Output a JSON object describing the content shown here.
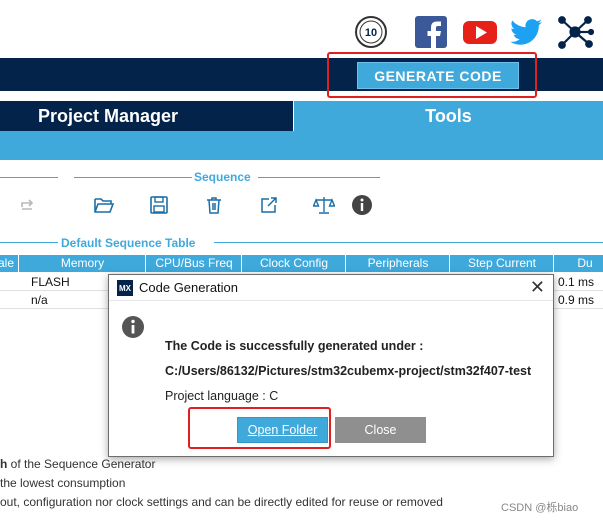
{
  "header": {
    "generate_label": "GENERATE CODE"
  },
  "social_icons": [
    "anniversary-badge-icon",
    "facebook-icon",
    "youtube-icon",
    "twitter-icon",
    "network-icon"
  ],
  "badge": {
    "number": "10"
  },
  "tabs": [
    {
      "label": "Project Manager"
    },
    {
      "label": "Tools"
    }
  ],
  "sequence": {
    "title": "Sequence",
    "toolbar_icons": [
      "redo-icon",
      "open-folder-icon",
      "save-icon",
      "delete-icon",
      "export-icon",
      "balance-icon",
      "info-icon"
    ]
  },
  "table": {
    "title": "Default Sequence Table",
    "columns": [
      "ale",
      "Memory",
      "CPU/Bus Freq",
      "Clock Config",
      "Peripherals",
      "Step Current",
      "Du"
    ],
    "rows": [
      {
        "memory": "FLASH",
        "duration": "0.1 ms"
      },
      {
        "memory": "n/a",
        "duration": "0.9 ms"
      }
    ]
  },
  "description": {
    "line1_bold": "h",
    "line1_rest": " of the Sequence Generator",
    "line2": "the lowest consumption",
    "line3": "out, configuration nor clock settings and can be directly edited for reuse or removed"
  },
  "watermark": "CSDN @栎biao",
  "dialog": {
    "logo": "MX",
    "title": "Code Generation",
    "close_glyph": "✕",
    "message": "The Code is successfully generated under :",
    "path": "C:/Users/86132/Pictures/stm32cubemx-project/stm32f407-test",
    "language": "Project language : C",
    "open_folder_label": "Open Folder",
    "close_label": "Close"
  },
  "colors": {
    "navy": "#03234b",
    "accent_blue": "#3fa9dc",
    "annotation_red": "#e02020",
    "close_gray": "#8f8f8f"
  }
}
